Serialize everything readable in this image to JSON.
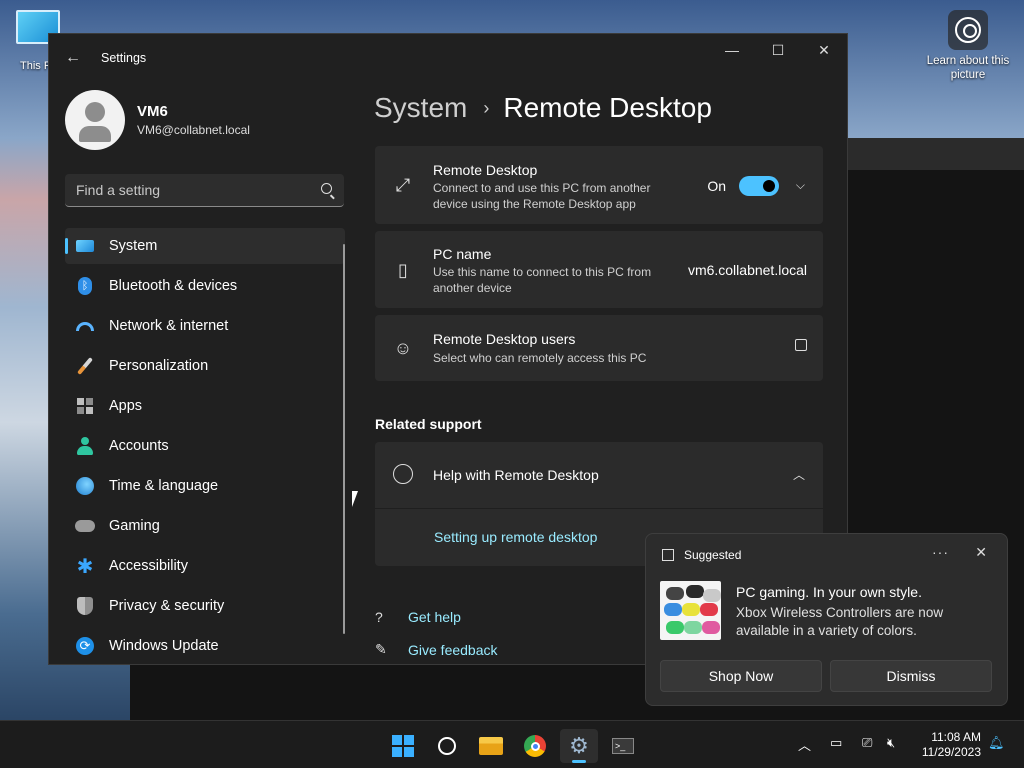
{
  "desktop": {
    "icon_label": "This PC",
    "learn_label": "Learn about this picture"
  },
  "window": {
    "title": "Settings",
    "controls": {
      "minimize": "—",
      "maximize": "☐",
      "close": "✕"
    }
  },
  "profile": {
    "name": "VM6",
    "email": "VM6@collabnet.local"
  },
  "search": {
    "placeholder": "Find a setting"
  },
  "sidebar": {
    "items": [
      {
        "label": "System",
        "icon": "system-icon",
        "selected": true
      },
      {
        "label": "Bluetooth & devices",
        "icon": "bluetooth-icon"
      },
      {
        "label": "Network & internet",
        "icon": "wifi-icon"
      },
      {
        "label": "Personalization",
        "icon": "brush-icon"
      },
      {
        "label": "Apps",
        "icon": "apps-icon"
      },
      {
        "label": "Accounts",
        "icon": "person-icon"
      },
      {
        "label": "Time & language",
        "icon": "globe-clock-icon"
      },
      {
        "label": "Gaming",
        "icon": "gamepad-icon"
      },
      {
        "label": "Accessibility",
        "icon": "accessibility-icon"
      },
      {
        "label": "Privacy & security",
        "icon": "shield-icon"
      },
      {
        "label": "Windows Update",
        "icon": "update-icon"
      }
    ]
  },
  "breadcrumb": {
    "parent": "System",
    "separator": "›",
    "current": "Remote Desktop"
  },
  "cards": {
    "remote_desktop": {
      "title": "Remote Desktop",
      "desc": "Connect to and use this PC from another device using the Remote Desktop app",
      "toggle_label": "On",
      "toggle_on": true
    },
    "pc_name": {
      "title": "PC name",
      "desc": "Use this name to connect to this PC from another device",
      "value": "vm6.collabnet.local"
    },
    "users": {
      "title": "Remote Desktop users",
      "desc": "Select who can remotely access this PC"
    }
  },
  "related": {
    "heading": "Related support",
    "help_title": "Help with Remote Desktop",
    "help_link": "Setting up remote desktop"
  },
  "footer_links": {
    "get_help": "Get help",
    "feedback": "Give feedback"
  },
  "toast": {
    "header": "Suggested",
    "more": "···",
    "close": "✕",
    "title": "PC gaming. In your own style.",
    "body": "Xbox Wireless Controllers are now available in a variety of colors.",
    "primary": "Shop Now",
    "secondary": "Dismiss"
  },
  "taskbar": {
    "time": "11:08 AM",
    "date": "11/29/2023",
    "accent": "#4cc2ff"
  }
}
